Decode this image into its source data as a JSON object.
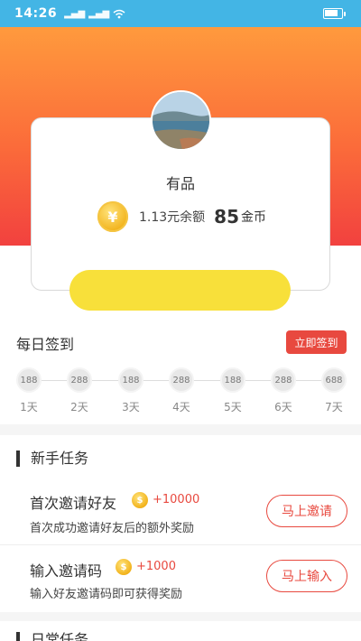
{
  "status_bar": {
    "time": "14:26",
    "signal1": "▂▄▆",
    "signal2": "▂▄▆",
    "wifi": "wifi-icon"
  },
  "profile": {
    "nickname": "有品",
    "coin_symbol": "¥",
    "balance_text": "1.13元余额",
    "coins_value": "85",
    "coins_unit": "金币"
  },
  "daily_checkin": {
    "title": "每日签到",
    "button_label": "立即签到",
    "days": [
      {
        "reward": "188",
        "label": "1天"
      },
      {
        "reward": "288",
        "label": "2天"
      },
      {
        "reward": "188",
        "label": "3天"
      },
      {
        "reward": "288",
        "label": "4天"
      },
      {
        "reward": "188",
        "label": "5天"
      },
      {
        "reward": "288",
        "label": "6天"
      },
      {
        "reward": "688",
        "label": "7天"
      }
    ]
  },
  "newbie_section": {
    "title": "新手任务",
    "tasks": [
      {
        "title": "首次邀请好友",
        "coin_symbol": "$",
        "reward": "+10000",
        "desc": "首次成功邀请好友后的额外奖励",
        "button": "马上邀请"
      },
      {
        "title": "输入邀请码",
        "coin_symbol": "$",
        "reward": "+1000",
        "desc": "输入好友邀请码即可获得奖励",
        "button": "马上输入"
      }
    ]
  },
  "daily_section": {
    "title": "日常任务"
  },
  "colors": {
    "status_bar": "#43b5e5",
    "accent_red": "#e8493f",
    "yellow_button": "#f8e03a",
    "gradient_top": "#ff9a3d",
    "gradient_bottom": "#f2413f"
  }
}
